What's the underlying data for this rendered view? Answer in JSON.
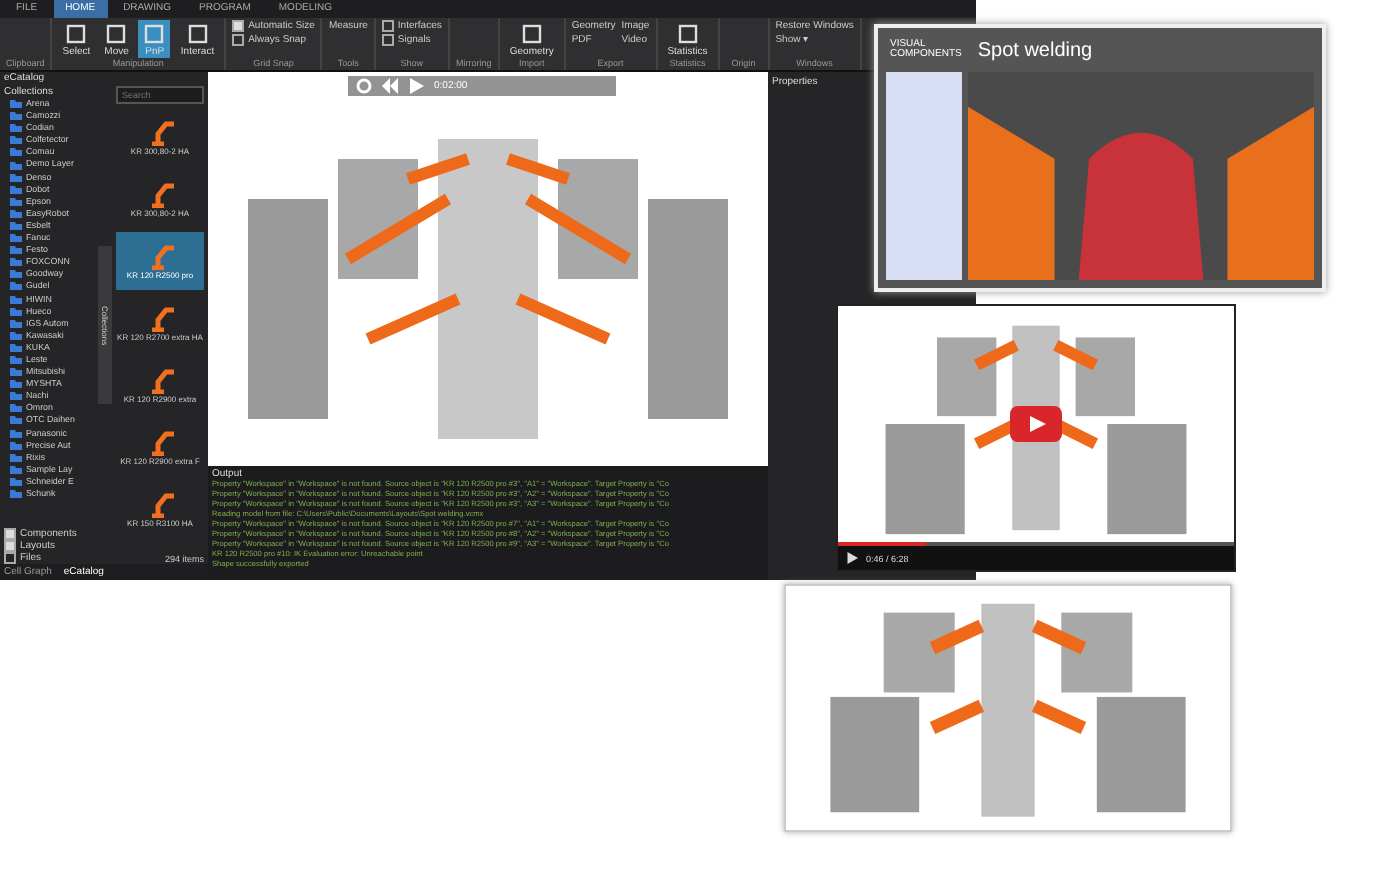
{
  "app": {
    "tabs": [
      {
        "label": "FILE",
        "selected": false
      },
      {
        "label": "HOME",
        "selected": true
      },
      {
        "label": "DRAWING",
        "selected": false
      },
      {
        "label": "PROGRAM",
        "selected": false
      },
      {
        "label": "MODELING",
        "selected": false
      }
    ],
    "groups": [
      {
        "label": "Clipboard"
      },
      {
        "label": "Manipulation",
        "items": [
          {
            "kind": "big",
            "label": "Select",
            "selected": false
          },
          {
            "kind": "big",
            "label": "Move",
            "selected": false
          },
          {
            "kind": "big",
            "label": "PnP",
            "selected": true
          },
          {
            "kind": "big",
            "label": "Interact",
            "selected": false
          }
        ]
      },
      {
        "label": "Grid Snap",
        "items": [
          {
            "kind": "check",
            "label": "Automatic Size",
            "checked": true
          },
          {
            "kind": "check",
            "label": "Always Snap",
            "checked": false
          }
        ]
      },
      {
        "label": "Tools",
        "items": [
          {
            "kind": "small",
            "label": "Measure"
          }
        ]
      },
      {
        "label": "Show",
        "items": [
          {
            "kind": "check",
            "label": "Interfaces",
            "checked": false
          },
          {
            "kind": "check",
            "label": "Signals",
            "checked": false
          }
        ]
      },
      {
        "label": "Mirroring"
      },
      {
        "label": "Import",
        "items": [
          {
            "kind": "big",
            "label": "Geometry",
            "selected": false
          }
        ]
      },
      {
        "label": "Export",
        "items": [
          {
            "kind": "small",
            "label": "Geometry"
          },
          {
            "kind": "small",
            "label": "PDF"
          },
          {
            "kind": "small",
            "label": "Image"
          },
          {
            "kind": "small",
            "label": "Video"
          }
        ]
      },
      {
        "label": "Statistics",
        "items": [
          {
            "kind": "big",
            "label": "Statistics",
            "selected": false
          }
        ]
      },
      {
        "label": "Origin"
      },
      {
        "label": "Windows",
        "items": [
          {
            "kind": "small",
            "label": "Restore Windows"
          },
          {
            "kind": "small",
            "label": "Show ▾"
          }
        ]
      }
    ]
  },
  "ecatalog": {
    "title": "eCatalog",
    "collections_label": "Collections",
    "search": {
      "placeholder": "Search"
    },
    "collections": [
      {
        "label": "Arena"
      },
      {
        "label": "Camozzi"
      },
      {
        "label": "Codian"
      },
      {
        "label": "Colfetector"
      },
      {
        "label": "Comau"
      },
      {
        "label": "Demo Layer"
      },
      {
        "label": "Denso"
      },
      {
        "label": "Dobot"
      },
      {
        "label": "Epson"
      },
      {
        "label": "EasyRobot"
      },
      {
        "label": "Esbelt"
      },
      {
        "label": "Fanuc"
      },
      {
        "label": "Festo"
      },
      {
        "label": "FOXCONN"
      },
      {
        "label": "Goodway"
      },
      {
        "label": "Gudel"
      },
      {
        "label": "HIWIN"
      },
      {
        "label": "Hueco"
      },
      {
        "label": "IGS Autom"
      },
      {
        "label": "Kawasaki"
      },
      {
        "label": "KUKA"
      },
      {
        "label": "Leste"
      },
      {
        "label": "Mitsubishi"
      },
      {
        "label": "MYSHTA"
      },
      {
        "label": "Nachi"
      },
      {
        "label": "Omron"
      },
      {
        "label": "OTC Daihen"
      },
      {
        "label": "Panasonic"
      },
      {
        "label": "Precise Aut"
      },
      {
        "label": "Rixis"
      },
      {
        "label": "Sample Lay"
      },
      {
        "label": "Schneider E"
      },
      {
        "label": "Schunk"
      }
    ],
    "filters": [
      {
        "label": "Components",
        "checked": true
      },
      {
        "label": "Layouts",
        "checked": true
      },
      {
        "label": "Files",
        "checked": false
      }
    ],
    "side_tab": "Collections",
    "items": [
      {
        "label": "KR 300,80-2 HA",
        "selected": false
      },
      {
        "label": "KR 300,80-2 HA",
        "selected": false
      },
      {
        "label": "KR 120 R2500 pro",
        "selected": true
      },
      {
        "label": "KR 120 R2700 extra HA",
        "selected": false
      },
      {
        "label": "KR 120 R2900 extra",
        "selected": false
      },
      {
        "label": "KR 120 R2900 extra F",
        "selected": false
      },
      {
        "label": "KR 150 R3100 HA",
        "selected": false
      }
    ],
    "count": "294 items",
    "bottom_tabs": [
      {
        "label": "Cell Graph",
        "selected": false
      },
      {
        "label": "eCatalog",
        "selected": true
      }
    ]
  },
  "viewport": {
    "time": "0:02:00"
  },
  "output": {
    "title": "Output",
    "lines": [
      "Property \"Workspace\" in \"Workspace\" is not found. Source object is \"KR 120 R2500 pro #3\", \"A1\" = \"Workspace\". Target Property is \"Co",
      "Property \"Workspace\" in \"Workspace\" is not found. Source object is \"KR 120 R2500 pro #3\", \"A2\" = \"Workspace\". Target Property is \"Co",
      "Property \"Workspace\" in \"Workspace\" is not found. Source object is \"KR 120 R2500 pro #3\", \"A3\" = \"Workspace\". Target Property is \"Co",
      "Reading model from file: C:\\Users\\Public\\Documents\\Layouts\\Spot welding.vcmx",
      "Property \"Workspace\" in \"Workspace\" is not found. Source object is \"KR 120 R2500 pro #7\", \"A1\" = \"Workspace\". Target Property is \"Co",
      "Property \"Workspace\" in \"Workspace\" is not found. Source object is \"KR 120 R2500 pro #8\", \"A2\" = \"Workspace\". Target Property is \"Co",
      "Property \"Workspace\" in \"Workspace\" is not found. Source object is \"KR 120 R2500 pro #9\", \"A3\" = \"Workspace\". Target Property is \"Co",
      "KR 120 R2500 pro #10: IK Evaluation error: Unreachable point",
      "Shape successfully exported"
    ]
  },
  "properties": {
    "title": "Properties"
  },
  "spot_welding": {
    "logo_top": "VISUAL",
    "logo_bottom": "COMPONENTS",
    "title": "Spot welding"
  },
  "video": {
    "time": "0:46 / 6:28",
    "progress": {
      "level": 0.22
    }
  }
}
